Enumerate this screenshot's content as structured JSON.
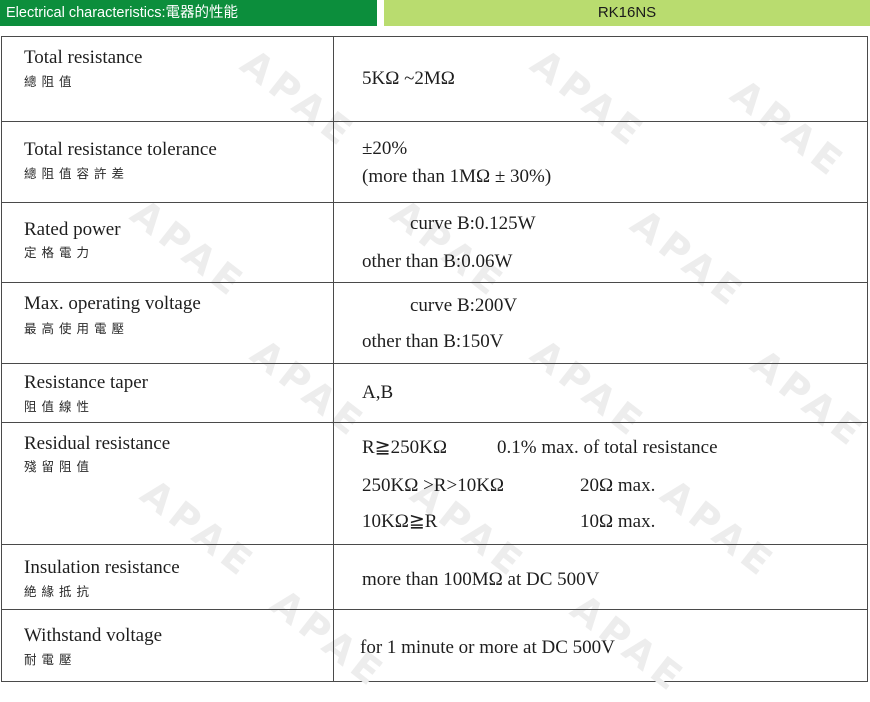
{
  "header": {
    "left_title": "Electrical characteristics:電器的性能",
    "right_title": "RK16NS"
  },
  "watermark": "APAE",
  "rows": [
    {
      "name": "Total resistance",
      "cjk": "總阻值",
      "values": [
        "5KΩ ~2MΩ"
      ]
    },
    {
      "name": "Total resistance tolerance",
      "cjk": "總阻值容許差",
      "values": [
        "±20%",
        "(more than 1MΩ  ± 30%)"
      ]
    },
    {
      "name": "Rated power",
      "cjk": "定格電力",
      "values": [
        "curve B:0.125W",
        "other than B:0.06W"
      ]
    },
    {
      "name": "Max. operating voltage",
      "cjk": "最高使用電壓",
      "values": [
        "curve B:200V",
        "other than B:150V"
      ]
    },
    {
      "name": "Resistance taper",
      "cjk": "阻值線性",
      "values": [
        "A,B"
      ]
    },
    {
      "name": "Residual resistance",
      "cjk": "殘留阻值",
      "values": [
        "R≧250KΩ",
        "0.1% max. of  total  resistance",
        "250KΩ >R>10KΩ",
        "20Ω max.",
        "10KΩ≧R",
        "10Ω max."
      ]
    },
    {
      "name": "Insulation resistance",
      "cjk": "絶緣抵抗",
      "values": [
        "more than 100MΩ  at DC 500V"
      ]
    },
    {
      "name": "Withstand voltage",
      "cjk": "耐電壓",
      "values": [
        "for 1 minute or more at DC 500V"
      ]
    }
  ]
}
